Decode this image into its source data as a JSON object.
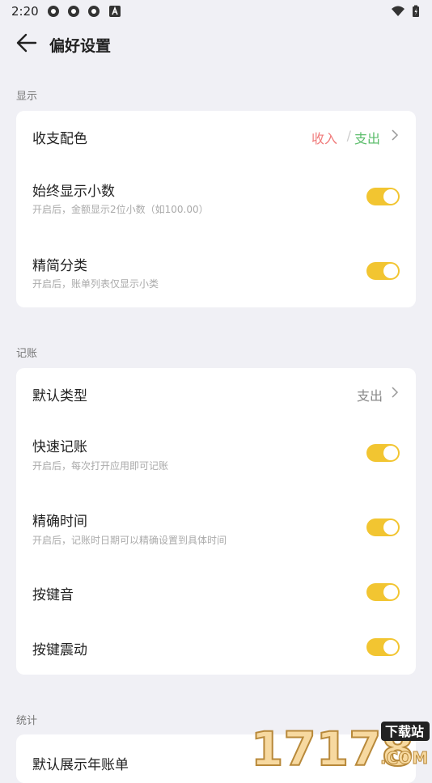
{
  "status_bar": {
    "time": "2:20"
  },
  "header": {
    "title": "偏好设置"
  },
  "sections": {
    "display": {
      "label": "显示",
      "color_scheme": {
        "label": "收支配色",
        "income": "收入",
        "slash": "/",
        "expense": "支出"
      },
      "show_decimal": {
        "label": "始终显示小数",
        "desc": "开启后，金额显示2位小数（如100.00）",
        "on": true
      },
      "simple_category": {
        "label": "精简分类",
        "desc": "开启后，账单列表仅显示小类",
        "on": true
      }
    },
    "bookkeeping": {
      "label": "记账",
      "default_type": {
        "label": "默认类型",
        "value": "支出"
      },
      "quick_entry": {
        "label": "快速记账",
        "desc": "开启后，每次打开应用即可记账",
        "on": true
      },
      "precise_time": {
        "label": "精确时间",
        "desc": "开启后，记账时日期可以精确设置到具体时间",
        "on": true
      },
      "key_sound": {
        "label": "按键音",
        "on": true
      },
      "key_vibrate": {
        "label": "按键震动",
        "on": true
      }
    },
    "stats": {
      "label": "统计",
      "default_year": {
        "label": "默认展示年账单"
      }
    }
  },
  "watermark": {
    "text": "17178",
    "badge": "下载站",
    "suffix": ".COM"
  },
  "colors": {
    "accent": "#f2c531",
    "income": "#f07b7b",
    "expense": "#5bbd6b",
    "background": "#f0f0f5"
  }
}
